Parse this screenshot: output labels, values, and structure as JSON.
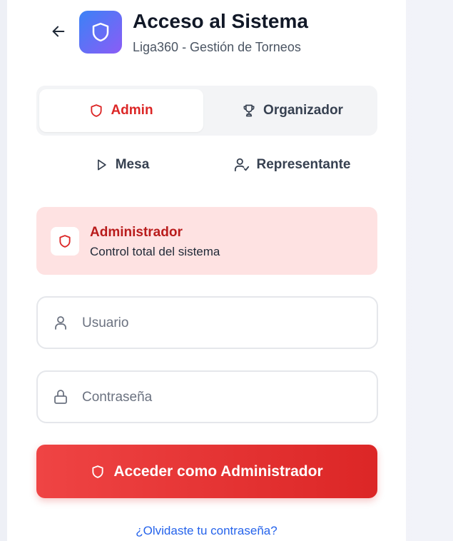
{
  "header": {
    "title": "Acceso al Sistema",
    "subtitle": "Liga360 - Gestión de Torneos"
  },
  "roles": [
    {
      "label": "Admin",
      "icon": "shield-icon",
      "active": true
    },
    {
      "label": "Organizador",
      "icon": "trophy-icon",
      "active": false
    },
    {
      "label": "Mesa",
      "icon": "play-icon",
      "active": false
    },
    {
      "label": "Representante",
      "icon": "user-check-icon",
      "active": false
    }
  ],
  "role_card": {
    "title": "Administrador",
    "description": "Control total del sistema",
    "icon": "shield-icon"
  },
  "form": {
    "username_placeholder": "Usuario",
    "username_value": "",
    "password_placeholder": "Contraseña",
    "password_value": "",
    "submit_label": "Acceder como Administrador",
    "forgot_label": "¿Olvidaste tu contraseña?"
  },
  "colors": {
    "accent": "#dc2626",
    "card_bg": "#fee2e2",
    "logo_from": "#3b82f6",
    "logo_to": "#8b5cf6",
    "link": "#2563eb"
  }
}
